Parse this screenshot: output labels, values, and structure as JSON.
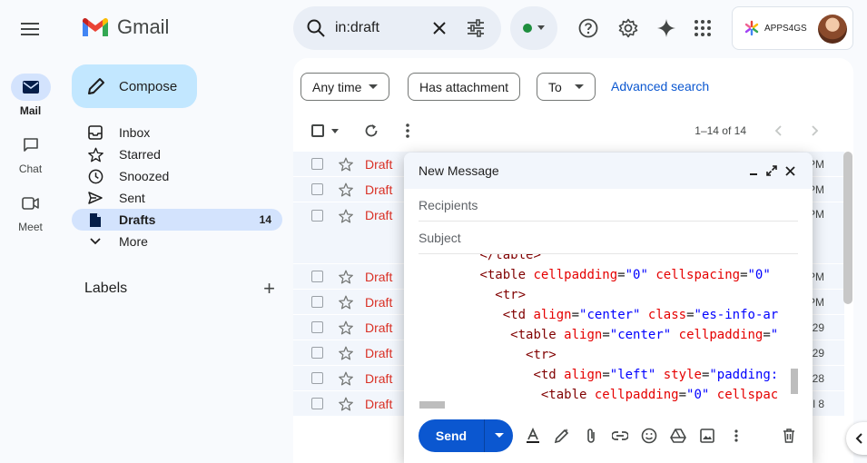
{
  "app": {
    "name": "Gmail"
  },
  "rail": [
    {
      "label": "Mail",
      "icon": "mail-icon",
      "active": true
    },
    {
      "label": "Chat",
      "icon": "chat-icon",
      "active": false
    },
    {
      "label": "Meet",
      "icon": "meet-icon",
      "active": false
    }
  ],
  "search": {
    "query": "in:draft"
  },
  "account": {
    "org": "APPS4GS"
  },
  "compose": {
    "label": "Compose"
  },
  "nav": [
    {
      "label": "Inbox",
      "count": "",
      "icon": "inbox-icon"
    },
    {
      "label": "Starred",
      "count": "",
      "icon": "star-icon"
    },
    {
      "label": "Snoozed",
      "count": "",
      "icon": "clock-icon"
    },
    {
      "label": "Sent",
      "count": "",
      "icon": "send-icon"
    },
    {
      "label": "Drafts",
      "count": "14",
      "icon": "draft-icon",
      "active": true
    },
    {
      "label": "More",
      "count": "",
      "icon": "chevron-down-icon"
    }
  ],
  "labels": {
    "title": "Labels"
  },
  "filters": {
    "any_time": "Any time",
    "has_attachment": "Has attachment",
    "to": "To",
    "advanced": "Advanced search"
  },
  "pager": {
    "text": "1–14 of 14"
  },
  "rows": [
    {
      "label": "Draft",
      "date": "PM"
    },
    {
      "label": "Draft",
      "date": "PM"
    },
    {
      "label": "Draft",
      "date": "PM"
    },
    {
      "label": "Draft",
      "date": "PM"
    },
    {
      "label": "Draft",
      "date": "PM"
    },
    {
      "label": "Draft",
      "date": "29"
    },
    {
      "label": "Draft",
      "date": "29"
    },
    {
      "label": "Draft",
      "date": "28"
    },
    {
      "label": "Draft",
      "date": "l 8"
    }
  ],
  "message": {
    "title": "New Message",
    "recipients_placeholder": "Recipients",
    "subject_placeholder": "Subject",
    "send_label": "Send"
  },
  "colors": {
    "accent": "#0b57d0",
    "compose_bg": "#c2e7ff",
    "active_nav": "#d3e3fd",
    "draft_red": "#d93025"
  }
}
